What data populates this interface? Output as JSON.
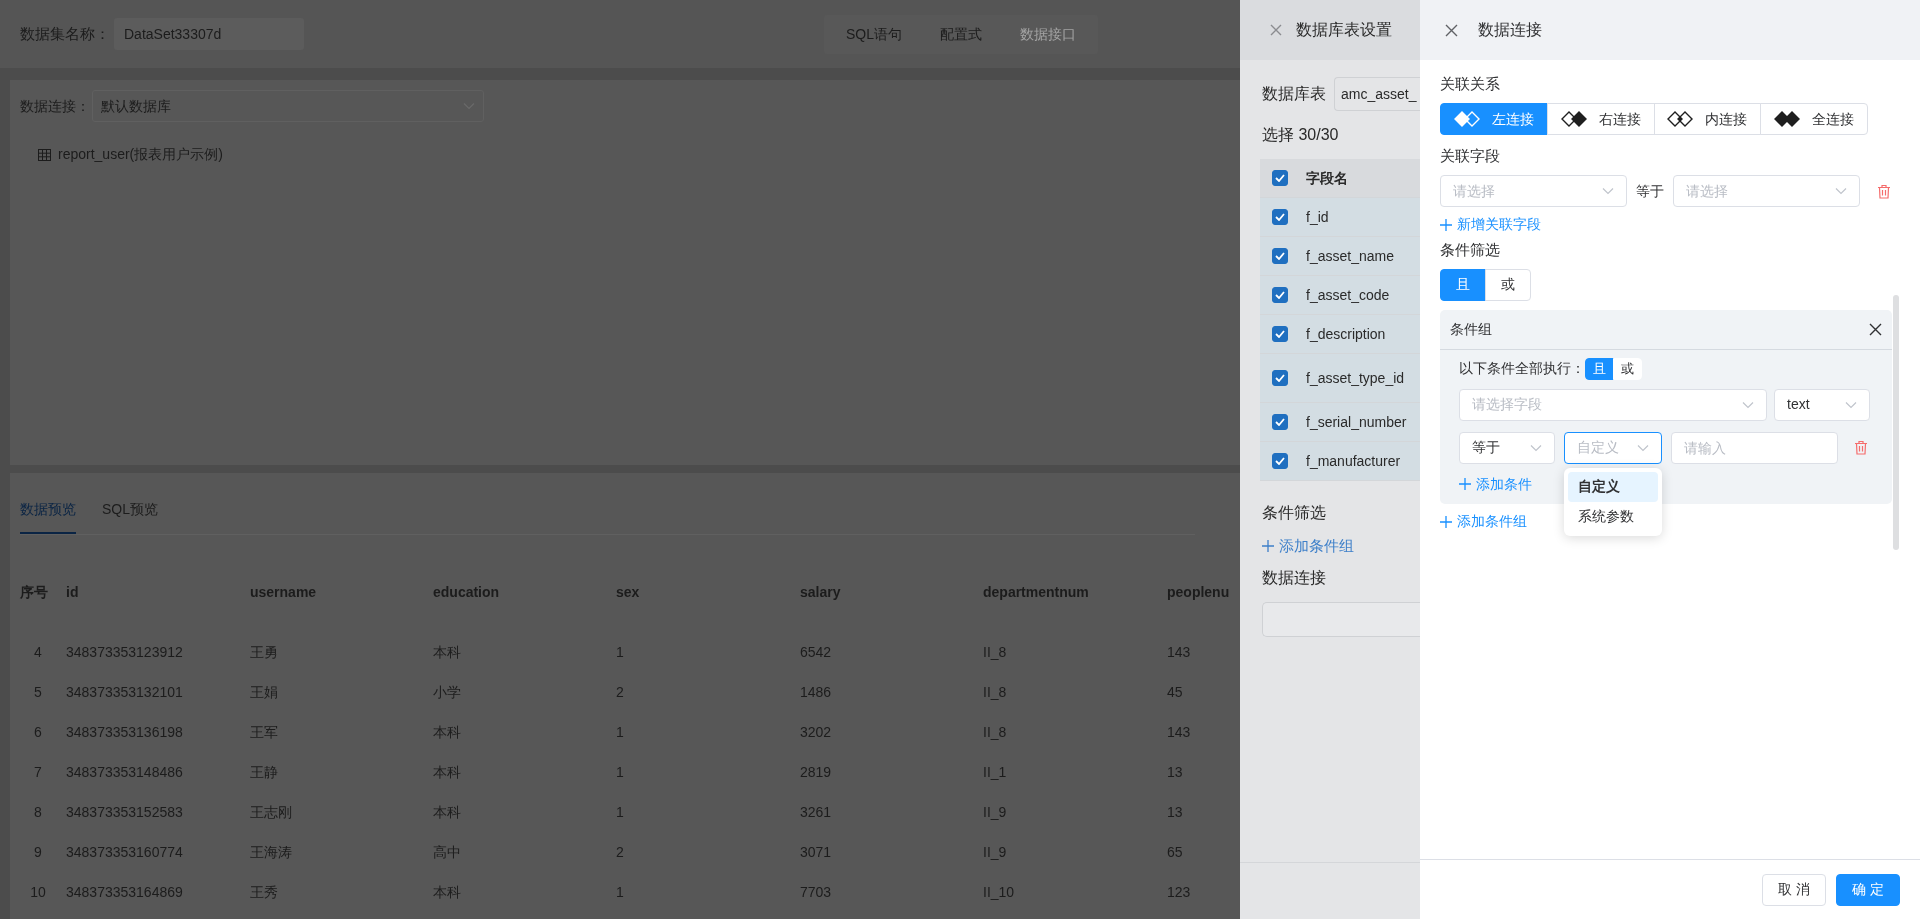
{
  "header": {
    "label": "数据集名称：",
    "name_value": "DataSet33307d",
    "modes": [
      {
        "label": "SQL语句",
        "disabled": false
      },
      {
        "label": "配置式",
        "disabled": false
      },
      {
        "label": "数据接口",
        "disabled": true
      }
    ]
  },
  "connection": {
    "label": "数据连接：",
    "value": "默认数据库"
  },
  "tables": [
    {
      "label": "report_user(报表用户示例)"
    }
  ],
  "preview_tabs": [
    {
      "label": "数据预览",
      "selected": true
    },
    {
      "label": "SQL预览",
      "selected": false
    }
  ],
  "table": {
    "columns": [
      "序号",
      "id",
      "username",
      "education",
      "sex",
      "salary",
      "departmentnum",
      "peoplenu"
    ],
    "rows": [
      [
        "4",
        "348373353123912",
        "王勇",
        "本科",
        "1",
        "6542",
        "II_8",
        "143"
      ],
      [
        "5",
        "348373353132101",
        "王娟",
        "小学",
        "2",
        "1486",
        "II_8",
        "45"
      ],
      [
        "6",
        "348373353136198",
        "王军",
        "本科",
        "1",
        "3202",
        "II_8",
        "143"
      ],
      [
        "7",
        "348373353148486",
        "王静",
        "本科",
        "1",
        "2819",
        "II_1",
        "13"
      ],
      [
        "8",
        "348373353152583",
        "王志刚",
        "本科",
        "1",
        "3261",
        "II_9",
        "13"
      ],
      [
        "9",
        "348373353160774",
        "王海涛",
        "高中",
        "2",
        "3071",
        "II_9",
        "65"
      ],
      [
        "10",
        "348373353164869",
        "王秀",
        "本科",
        "1",
        "7703",
        "II_10",
        "123"
      ]
    ]
  },
  "table_drawer": {
    "title": "数据库表设置",
    "table_label": "数据库表",
    "table_value": "amc_asset_",
    "selection_count": "选择 30/30",
    "field_header": "字段名",
    "all_checked": true,
    "fields": [
      {
        "name": "f_id",
        "checked": true
      },
      {
        "name": "f_asset_name",
        "checked": true
      },
      {
        "name": "f_asset_code",
        "checked": true
      },
      {
        "name": "f_description",
        "checked": true
      },
      {
        "name": "f_asset_type_id",
        "checked": true
      },
      {
        "name": "f_serial_number",
        "checked": true
      },
      {
        "name": "f_manufacturer",
        "checked": true
      }
    ],
    "filter_label": "条件筛选",
    "add_group": "添加条件组",
    "connection_label": "数据连接"
  },
  "join_drawer": {
    "title": "数据连接",
    "relation_label": "关联关系",
    "join_types": [
      {
        "kind": "left",
        "label": "左连接",
        "selected": true
      },
      {
        "kind": "right",
        "label": "右连接",
        "selected": false
      },
      {
        "kind": "inner",
        "label": "内连接",
        "selected": false
      },
      {
        "kind": "full",
        "label": "全连接",
        "selected": false
      }
    ],
    "field_label": "关联字段",
    "field_pairs": [
      {
        "left_placeholder": "请选择",
        "operator": "等于",
        "right_placeholder": "请选择"
      }
    ],
    "add_field": "新增关联字段",
    "filter_label": "条件筛选",
    "group_logic": [
      {
        "label": "且",
        "selected": true
      },
      {
        "label": "或",
        "selected": false
      }
    ],
    "groups": [
      {
        "title": "条件组",
        "logic_label": "以下条件全部执行：",
        "logic": [
          {
            "label": "且",
            "selected": true
          },
          {
            "label": "或",
            "selected": false
          }
        ],
        "conditions": [
          {
            "field_placeholder": "请选择字段",
            "type": "text",
            "operator": "等于",
            "source": {
              "placeholder": "自定义",
              "expanded": true,
              "options": [
                {
                  "label": "自定义",
                  "selected": true
                },
                {
                  "label": "系统参数",
                  "selected": false
                }
              ]
            },
            "value_placeholder": "请输入"
          }
        ],
        "add_condition": "添加条件"
      }
    ],
    "add_group": "添加条件组",
    "buttons": [
      {
        "label": "取 消",
        "kind": "default"
      },
      {
        "label": "确 定",
        "kind": "primary"
      }
    ]
  }
}
